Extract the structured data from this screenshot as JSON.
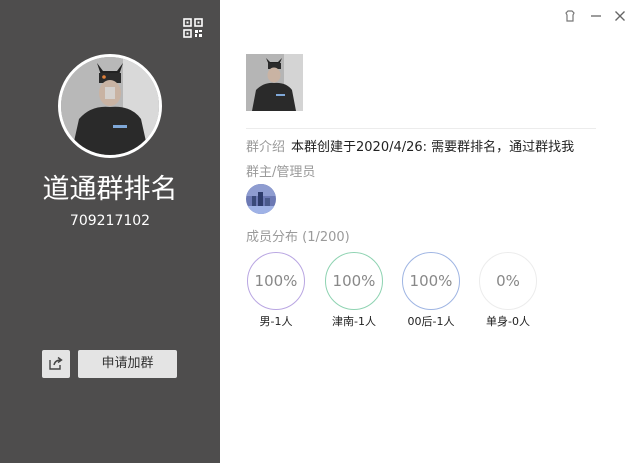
{
  "left_panel": {
    "group_name": "道通群排名",
    "group_id": "709217102",
    "join_button": "申请加群",
    "icons": {
      "qr": "qr-code-icon",
      "share": "share-icon"
    }
  },
  "window_controls": [
    "skin-icon",
    "minimize-icon",
    "close-icon"
  ],
  "right_panel": {
    "intro_label": "群介绍",
    "intro_text": "本群创建于2020/4/26: 需要群排名，通过群找我",
    "admin_label": "群主/管理员",
    "members_label": "成员分布 (1/200)",
    "stats": [
      {
        "percent": "100%",
        "caption": "男-1人",
        "color": "#b9a6e2"
      },
      {
        "percent": "100%",
        "caption": "津南-1人",
        "color": "#8fd3b2"
      },
      {
        "percent": "100%",
        "caption": "00后-1人",
        "color": "#9fb5e3"
      },
      {
        "percent": "0%",
        "caption": "单身-0人",
        "color": "#ececec"
      }
    ]
  },
  "colors": {
    "left_bg": "#4e4d4d",
    "button_bg": "#e4e4e4"
  }
}
